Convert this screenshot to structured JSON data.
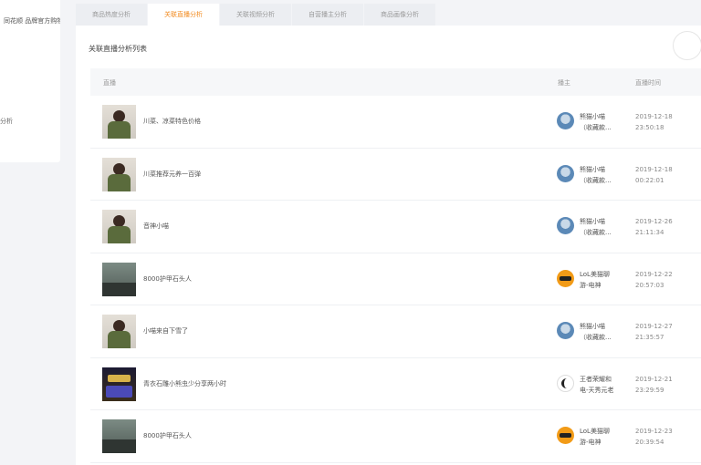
{
  "sidebar": {
    "line1": "同花顺  品牌官方购物已成首单",
    "line2": "分析"
  },
  "tabs": [
    {
      "label": "商品热度分析",
      "active": false
    },
    {
      "label": "关联直播分析",
      "active": true
    },
    {
      "label": "关联视频分析",
      "active": false
    },
    {
      "label": "自营播主分析",
      "active": false
    },
    {
      "label": "商品画像分析",
      "active": false
    }
  ],
  "panel": {
    "title": "关联直播分析列表",
    "columns": {
      "live": "直播",
      "anchor": "播主",
      "time": "直播时间"
    }
  },
  "rows": [
    {
      "title": "川菜、凉菜特色价格",
      "anchor": [
        "熊猫小喵",
        "（收藏款..."
      ],
      "time": [
        "2019-12-18",
        "23:50:18"
      ],
      "thumb": "person",
      "avatar": "a1"
    },
    {
      "title": "川菜推荐元养一百弹",
      "anchor": [
        "熊猫小喵",
        "（收藏款..."
      ],
      "time": [
        "2019-12-18",
        "00:22:01"
      ],
      "thumb": "person",
      "avatar": "a1"
    },
    {
      "title": "音神小喵",
      "anchor": [
        "熊猫小喵",
        "（收藏款..."
      ],
      "time": [
        "2019-12-26",
        "21:11:34"
      ],
      "thumb": "person",
      "avatar": "a1"
    },
    {
      "title": "8000护甲石头人",
      "anchor": [
        "LoL美猫聊",
        "游-电神"
      ],
      "time": [
        "2019-12-22",
        "20:57:03"
      ],
      "thumb": "game",
      "avatar": "a2"
    },
    {
      "title": "小喵来自下雪了",
      "anchor": [
        "熊猫小喵",
        "（收藏款..."
      ],
      "time": [
        "2019-12-27",
        "21:35:57"
      ],
      "thumb": "person",
      "avatar": "a1"
    },
    {
      "title": "青衣石雕小熊虫少分享两小时",
      "anchor": [
        "王者荣耀和",
        "电-天秀元老"
      ],
      "time": [
        "2019-12-21",
        "23:29:59"
      ],
      "thumb": "dark",
      "avatar": "a3"
    },
    {
      "title": "8000护甲石头人",
      "anchor": [
        "LoL美猫聊",
        "游-电神"
      ],
      "time": [
        "2019-12-23",
        "20:39:54"
      ],
      "thumb": "game",
      "avatar": "a2"
    }
  ]
}
